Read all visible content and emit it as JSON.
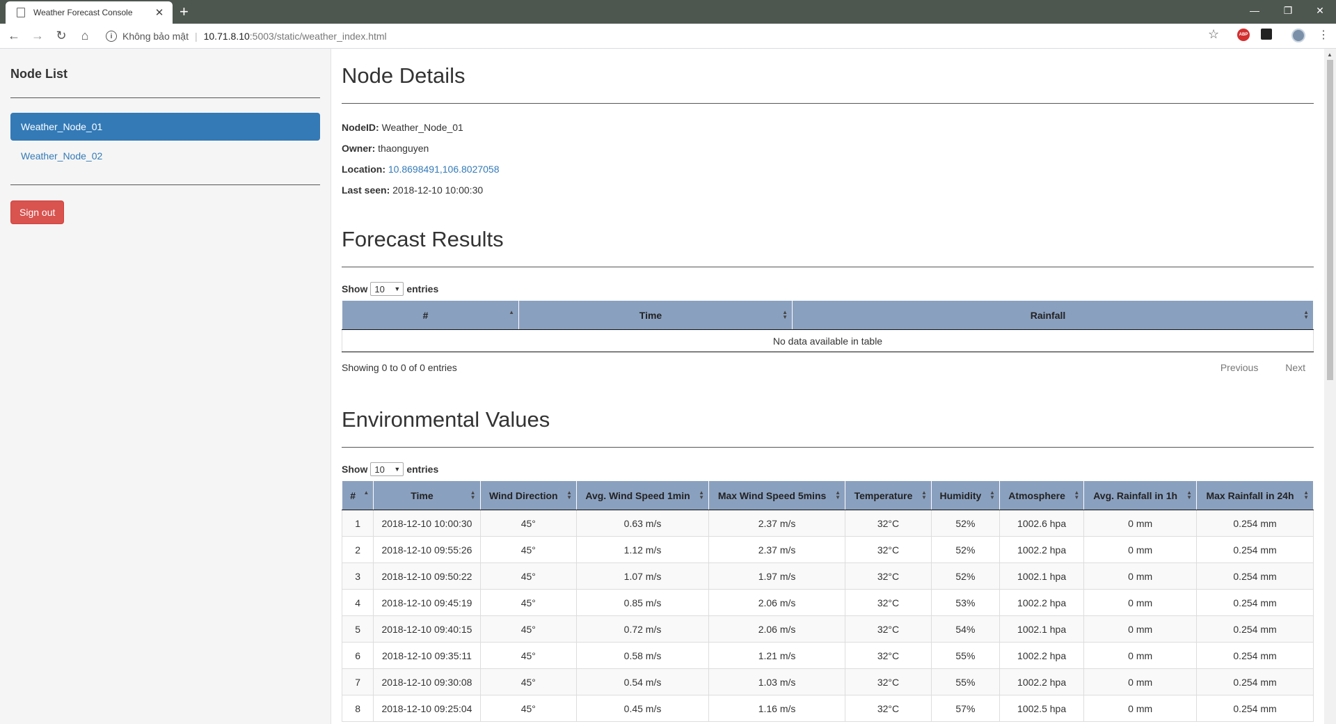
{
  "browser": {
    "tab_title": "Weather Forecast Console",
    "tab_close": "✕",
    "new_tab": "+",
    "security_text": "Không bảo mật",
    "url_host": "10.71.8.10",
    "url_path": ":5003/static/weather_index.html",
    "ext_abp": "ABP"
  },
  "sidebar": {
    "title": "Node List",
    "nodes": [
      {
        "label": "Weather_Node_01"
      },
      {
        "label": "Weather_Node_02"
      }
    ],
    "signout_label": "Sign out"
  },
  "node_details": {
    "heading": "Node Details",
    "nodeid_label": "NodeID:",
    "nodeid_value": "Weather_Node_01",
    "owner_label": "Owner:",
    "owner_value": "thaonguyen",
    "location_label": "Location:",
    "location_value": "10.8698491,106.8027058",
    "lastseen_label": "Last seen:",
    "lastseen_value": "2018-12-10 10:00:30"
  },
  "forecast": {
    "heading": "Forecast Results",
    "show_label": "Show",
    "entries_label": "entries",
    "page_size": "10",
    "columns": [
      "#",
      "Time",
      "Rainfall"
    ],
    "empty_text": "No data available in table",
    "info_text": "Showing 0 to 0 of 0 entries",
    "prev_label": "Previous",
    "next_label": "Next"
  },
  "environment": {
    "heading": "Environmental Values",
    "show_label": "Show",
    "entries_label": "entries",
    "page_size": "10",
    "columns": [
      "#",
      "Time",
      "Wind Direction",
      "Avg. Wind Speed 1min",
      "Max Wind Speed 5mins",
      "Temperature",
      "Humidity",
      "Atmosphere",
      "Avg. Rainfall in 1h",
      "Max Rainfall in 24h"
    ],
    "rows": [
      [
        "1",
        "2018-12-10 10:00:30",
        "45°",
        "0.63 m/s",
        "2.37 m/s",
        "32°C",
        "52%",
        "1002.6 hpa",
        "0 mm",
        "0.254 mm"
      ],
      [
        "2",
        "2018-12-10 09:55:26",
        "45°",
        "1.12 m/s",
        "2.37 m/s",
        "32°C",
        "52%",
        "1002.2 hpa",
        "0 mm",
        "0.254 mm"
      ],
      [
        "3",
        "2018-12-10 09:50:22",
        "45°",
        "1.07 m/s",
        "1.97 m/s",
        "32°C",
        "52%",
        "1002.1 hpa",
        "0 mm",
        "0.254 mm"
      ],
      [
        "4",
        "2018-12-10 09:45:19",
        "45°",
        "0.85 m/s",
        "2.06 m/s",
        "32°C",
        "53%",
        "1002.2 hpa",
        "0 mm",
        "0.254 mm"
      ],
      [
        "5",
        "2018-12-10 09:40:15",
        "45°",
        "0.72 m/s",
        "2.06 m/s",
        "32°C",
        "54%",
        "1002.1 hpa",
        "0 mm",
        "0.254 mm"
      ],
      [
        "6",
        "2018-12-10 09:35:11",
        "45°",
        "0.58 m/s",
        "1.21 m/s",
        "32°C",
        "55%",
        "1002.2 hpa",
        "0 mm",
        "0.254 mm"
      ],
      [
        "7",
        "2018-12-10 09:30:08",
        "45°",
        "0.54 m/s",
        "1.03 m/s",
        "32°C",
        "55%",
        "1002.2 hpa",
        "0 mm",
        "0.254 mm"
      ],
      [
        "8",
        "2018-12-10 09:25:04",
        "45°",
        "0.45 m/s",
        "1.16 m/s",
        "32°C",
        "57%",
        "1002.5 hpa",
        "0 mm",
        "0.254 mm"
      ]
    ]
  },
  "colors": {
    "primary": "#337ab7",
    "danger": "#d9534f",
    "table_header": "#8aa0bf",
    "chrome": "#4d564f"
  }
}
